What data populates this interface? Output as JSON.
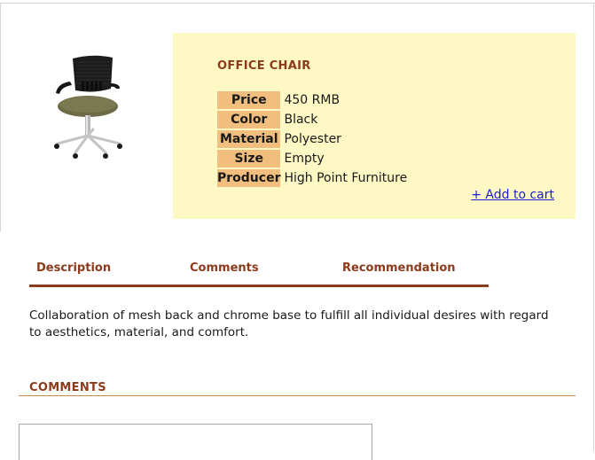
{
  "product": {
    "title": "OFFICE CHAIR",
    "attributes": [
      {
        "label": "Price",
        "value": "450 RMB"
      },
      {
        "label": "Color",
        "value": "Black"
      },
      {
        "label": "Material",
        "value": "Polyester"
      },
      {
        "label": "Size",
        "value": "Empty"
      },
      {
        "label": "Producer",
        "value": "High Point Furniture"
      }
    ],
    "add_to_cart": "+ Add to cart",
    "image_icon": "office-chair-image"
  },
  "tabs": [
    {
      "label": "Description"
    },
    {
      "label": "Comments"
    },
    {
      "label": "Recommendation"
    }
  ],
  "description": "Collaboration of mesh back and chrome base to fulfill all individual desires with regard to aesthetics, material, and comfort.",
  "comments": {
    "heading": "COMMENTS"
  },
  "colors": {
    "accent": "#8b3a1c",
    "panel_bg": "#fdf8c4",
    "label_bg": "#f2be7d",
    "link": "#1a1adb"
  }
}
